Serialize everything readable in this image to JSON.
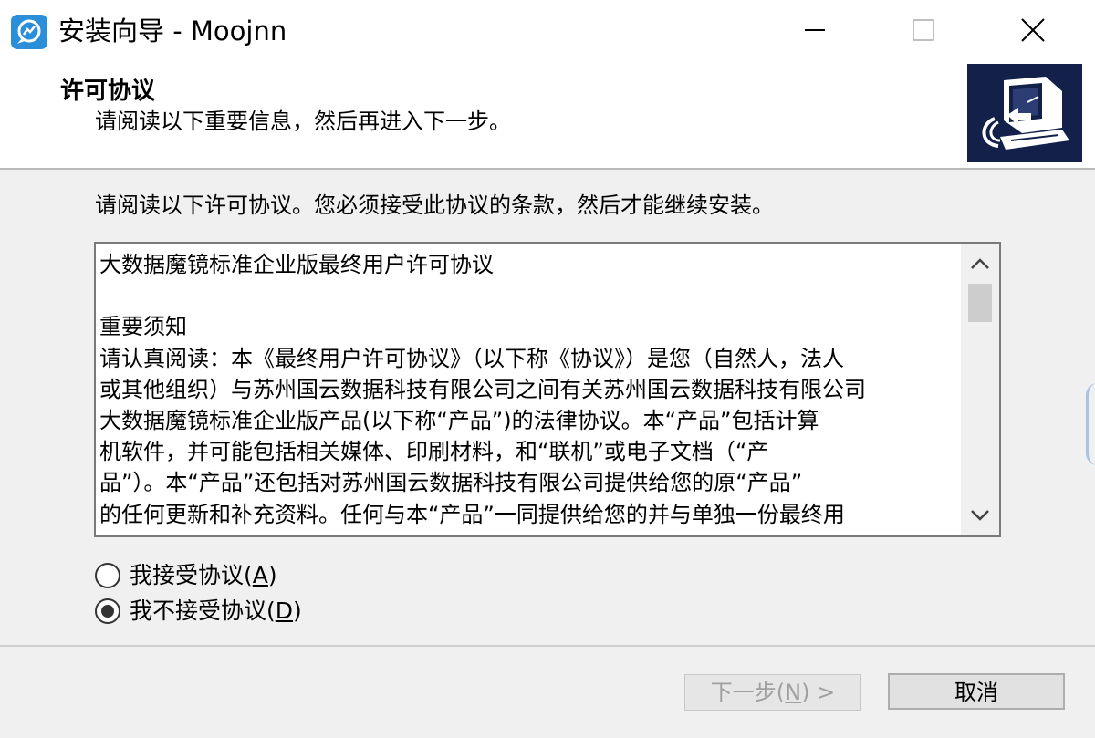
{
  "window": {
    "title": "安装向导 - Moojnn",
    "app_icon": "moojnn-app-icon",
    "controls": [
      "minimize-icon",
      "maximize-icon",
      "close-icon"
    ]
  },
  "header": {
    "title": "许可协议",
    "subtitle": "请阅读以下重要信息，然后再进入下一步。",
    "logo": "installer-computer-logo"
  },
  "body": {
    "instruction": "请阅读以下许可协议。您必须接受此协议的条款，然后才能继续安装。",
    "license_text": "大数据魔镜标准企业版最终用户许可协议\n\n重要须知\n请认真阅读：本《最终用户许可协议》（以下称《协议》）是您（自然人，法人\n或其他组织）与苏州国云数据科技有限公司之间有关苏州国云数据科技有限公司\n大数据魔镜标准企业版产品(以下称“产品”)的法律协议。本“产品”包括计算\n机软件，并可能包括相关媒体、印刷材料，和“联机”或电子文档（“产\n品”）。本“产品”还包括对苏州国云数据科技有限公司提供给您的原“产品”\n的任何更新和补充资料。任何与本“产品”一同提供给您的并与单独一份最终用"
  },
  "options": {
    "accept_label": "我接受协议(",
    "accept_key": "A",
    "accept_suffix": ")",
    "decline_label": "我不接受协议(",
    "decline_key": "D",
    "decline_suffix": ")",
    "selected": "decline"
  },
  "footer": {
    "next_label": "下一步(",
    "next_key": "N",
    "next_suffix": ") >",
    "next_enabled": false,
    "cancel_label": "取消"
  },
  "colors": {
    "accent": "#2a8fd8",
    "logo_bg": "#12204a",
    "background": "#f0f0f0"
  }
}
